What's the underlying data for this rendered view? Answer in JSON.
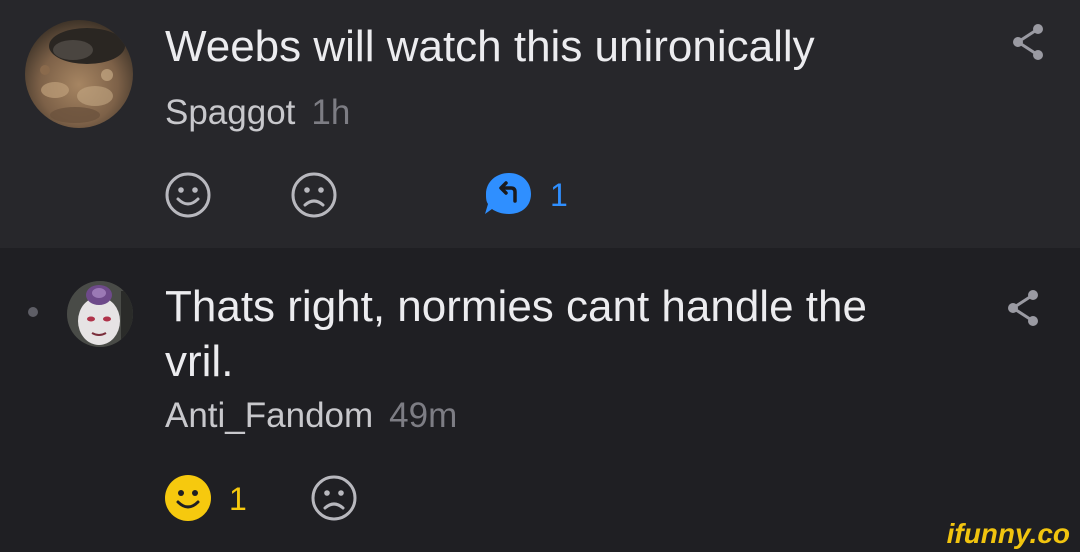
{
  "comments": [
    {
      "text": "Weebs will watch this unironically",
      "author": "Spaggot",
      "age": "1h",
      "reply_count": "1",
      "avatar_icon": "dirt-texture-avatar"
    },
    {
      "text_line1": "Thats right, normies cant handle the",
      "text_line2": "vril.",
      "author": "Anti_Fandom",
      "age": "49m",
      "smile_count": "1",
      "avatar_icon": "frieza-avatar"
    }
  ],
  "watermark": "ifunny.co",
  "colors": {
    "background_top": "#27272b",
    "background_bottom": "#1f1f23",
    "reply_accent": "#2f8fff",
    "smile_active": "#f6c90e",
    "icon_muted": "#b8b8be"
  },
  "icons": {
    "smile": "smile-icon",
    "unsmile": "unsmile-icon",
    "reply": "reply-icon",
    "share": "share-icon"
  }
}
